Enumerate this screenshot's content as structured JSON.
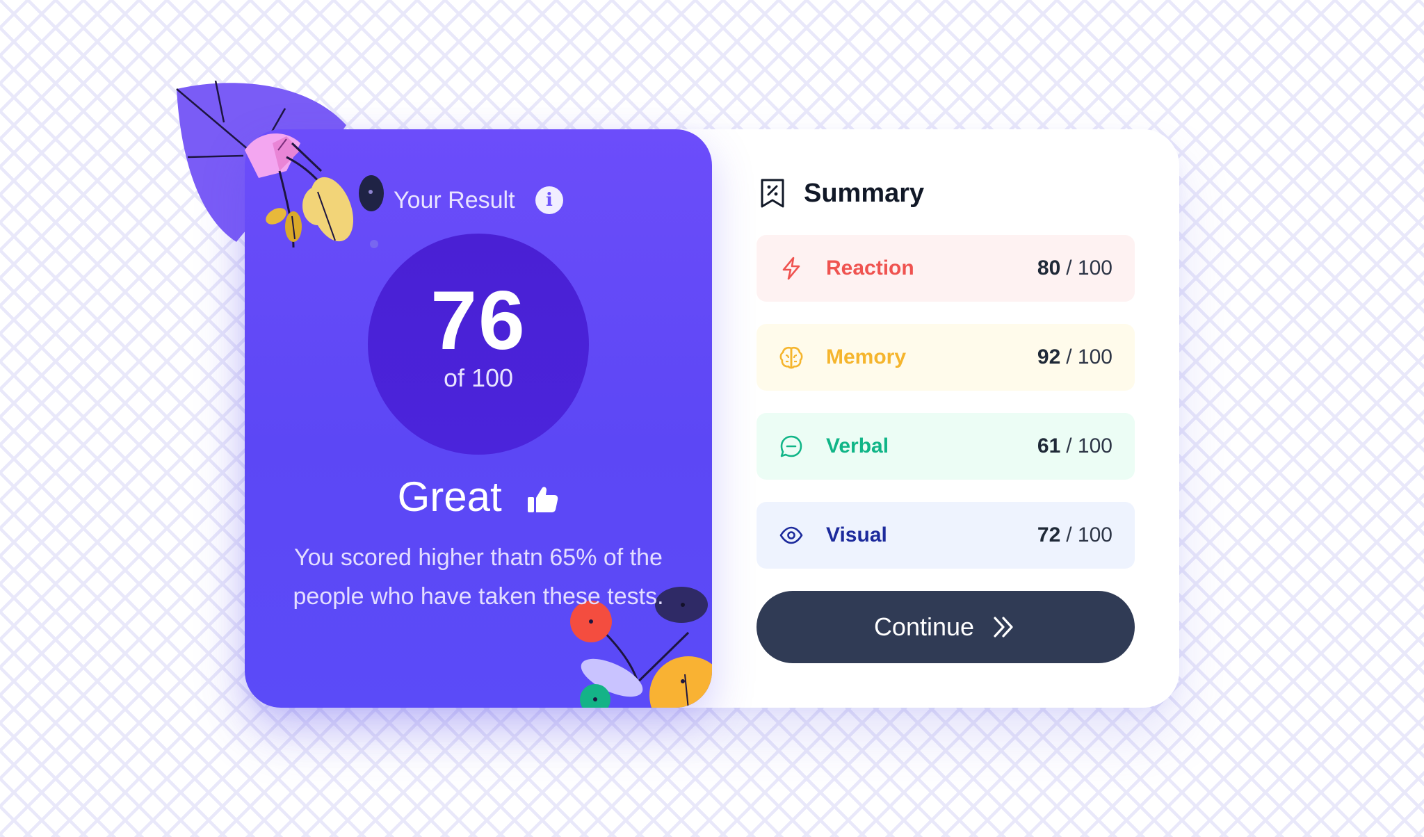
{
  "result": {
    "heading": "Your Result",
    "score": "76",
    "total": "of 100",
    "rating": "Great",
    "description": "You scored higher thatn 65% of the people who have taken these tests."
  },
  "summary": {
    "title": "Summary",
    "categories": [
      {
        "name": "Reaction",
        "score": "80",
        "max": "/ 100",
        "icon": "lightning-icon",
        "color": "#ef5350"
      },
      {
        "name": "Memory",
        "score": "92",
        "max": "/ 100",
        "icon": "brain-icon",
        "color": "#f5b52d"
      },
      {
        "name": "Verbal",
        "score": "61",
        "max": "/ 100",
        "icon": "chat-bubble-icon",
        "color": "#10b587"
      },
      {
        "name": "Visual",
        "score": "72",
        "max": "/ 100",
        "icon": "eye-icon",
        "color": "#1c2a9c"
      }
    ],
    "continue_label": "Continue"
  },
  "colors": {
    "panel_purple": "#6c4dfa",
    "circle_purple": "#4b24db",
    "button_navy": "#303b55"
  }
}
